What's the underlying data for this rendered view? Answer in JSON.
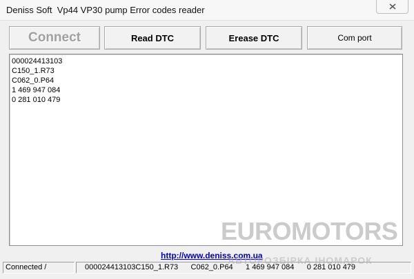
{
  "window": {
    "title": "Deniss Soft  Vp44 VP30 pump Error codes reader"
  },
  "toolbar": {
    "connect_label": "Connect",
    "read_label": "Read DTC",
    "erease_label": "Erease DTC",
    "com_label": "Com port"
  },
  "output": {
    "lines": [
      "000024413103",
      "C150_1.R73",
      "C062_0.P64",
      "1 469 947 084",
      "0 281 010 479"
    ]
  },
  "link": {
    "url_text": "http://www.deniss.com.ua"
  },
  "status": {
    "connection": "Connected /",
    "codes": "000024413103C150_1.R73      C062_0.P64      1 469 947 084      0 281 010 479"
  },
  "watermark": {
    "brand": "EUROMOTORS",
    "tagline": "АВТОРОЗБІРКА ІНОМАРОК"
  },
  "icons": {
    "close": "close-icon"
  }
}
